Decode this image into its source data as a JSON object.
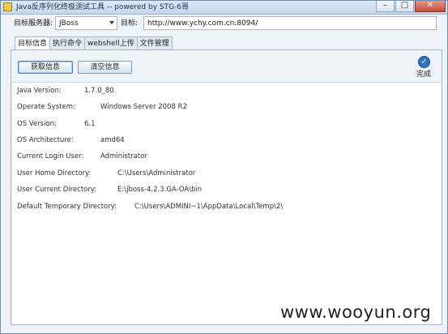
{
  "window": {
    "title": "Java反序列化终极测试工具 -- powered by STG-6哥",
    "minimize": "–",
    "maximize": "□",
    "close": "✕"
  },
  "toolbar": {
    "server_label": "目标服务器:",
    "server_value": "JBoss",
    "target_label": "目标:",
    "target_url": "http://www.ychy.com.cn:8094/"
  },
  "tabs": [
    {
      "label": "目标信息",
      "active": true
    },
    {
      "label": "执行命令",
      "active": false
    },
    {
      "label": "webshell上传",
      "active": false
    },
    {
      "label": "文件管理",
      "active": false
    }
  ],
  "buttons": {
    "fetch": "获取信息",
    "clear": "清空信息"
  },
  "status": {
    "icon": "check-circle-icon",
    "label": "完成"
  },
  "info": [
    {
      "key": "Java Version:",
      "value": "1.7.0_80"
    },
    {
      "key": "Operate System:",
      "value": "Windows Server 2008 R2"
    },
    {
      "key": "OS Version:",
      "value": "6.1"
    },
    {
      "key": "OS Architecture:",
      "value": "amd64"
    },
    {
      "key": "Current Login User:",
      "value": "Administrator"
    },
    {
      "key": "User Home Directory:",
      "value": "C:\\Users\\Administrator"
    },
    {
      "key": "User Current Directory:",
      "value": "E:\\jboss-4.2.3.GA-OA\\bin"
    },
    {
      "key": "Default Temporary Directory:",
      "value": "C:\\Users\\ADMINI~1\\AppData\\Local\\Temp\\2\\"
    }
  ],
  "watermark": "www.wooyun.org"
}
